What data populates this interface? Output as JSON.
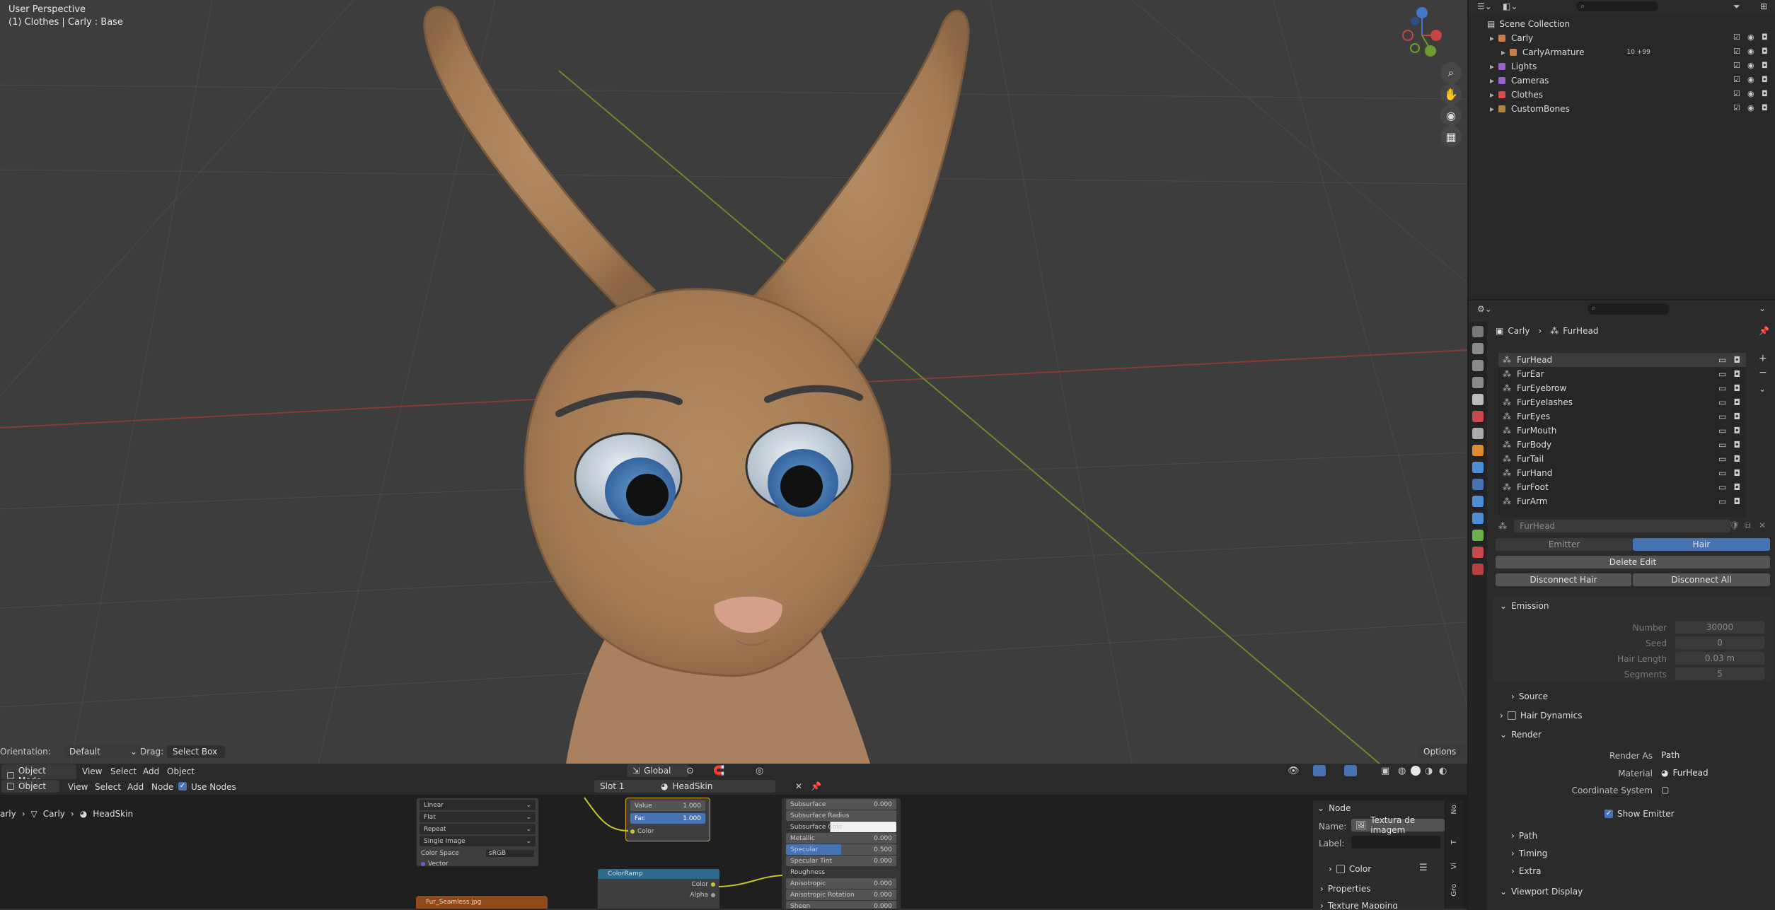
{
  "viewport": {
    "perspective": "User Perspective",
    "context": "(1) Clothes | Carly : Base",
    "orientation_label": "Orientation:",
    "orientation_value": "Default",
    "drag_label": "Drag:",
    "drag_value": "Select Box",
    "options_label": "Options"
  },
  "viewport_header": {
    "mode": "Object Mode",
    "menus": [
      "View",
      "Select",
      "Add",
      "Object"
    ],
    "transform_orientation": "Global"
  },
  "node_header": {
    "editor": "Object",
    "menus": [
      "View",
      "Select",
      "Add",
      "Node"
    ],
    "use_nodes_label": "Use Nodes",
    "slot": "Slot 1",
    "material": "HeadSkin"
  },
  "node_breadcrumb": {
    "items": [
      "arly",
      "Carly",
      "HeadSkin"
    ]
  },
  "node_sidebar": {
    "section": "Node",
    "name_label": "Name:",
    "name_value": "Textura de imagem",
    "label_label": "Label:",
    "color_label": "Color",
    "properties_label": "Properties",
    "texture_mapping_label": "Texture Mapping",
    "tabs": [
      "No",
      "T",
      "Vi",
      "Gro"
    ]
  },
  "nodes": {
    "image_texture": {
      "rows": [
        "Linear",
        "Flat",
        "Repeat",
        "Single Image"
      ],
      "color_space_label": "Color Space",
      "color_space_value": "sRGB",
      "vector_label": "Vector"
    },
    "fur_seamless": "Fur_Seamless.jpg",
    "mix": {
      "value_label": "Value",
      "value": "1.000",
      "fac_label": "Fac",
      "fac": "1.000",
      "color_label": "Color"
    },
    "colorramp": {
      "title": "ColorRamp",
      "color_label": "Color",
      "alpha_label": "Alpha"
    },
    "bsdf_rows": [
      {
        "label": "Subsurface",
        "value": "0.000"
      },
      {
        "label": "Subsurface Radius",
        "value": ""
      },
      {
        "label": "Subsurface Colo",
        "value": ""
      },
      {
        "label": "Metallic",
        "value": "0.000"
      },
      {
        "label": "Specular",
        "value": "0.500"
      },
      {
        "label": "Specular Tint",
        "value": "0.000"
      },
      {
        "label": "Roughness",
        "value": ""
      },
      {
        "label": "Anisotropic",
        "value": "0.000"
      },
      {
        "label": "Anisotropic Rotation",
        "value": "0.000"
      },
      {
        "label": "Sheen",
        "value": "0.000"
      }
    ]
  },
  "outliner": {
    "root": "Scene Collection",
    "items": [
      {
        "name": "Carly",
        "indent": 1,
        "color": "#c97f4a"
      },
      {
        "name": "CarlyArmature",
        "indent": 2,
        "color": "#c97f4a",
        "extra": "10 +99"
      },
      {
        "name": "Lights",
        "indent": 1,
        "color": "#9b62c9"
      },
      {
        "name": "Cameras",
        "indent": 1,
        "color": "#9b62c9"
      },
      {
        "name": "Clothes",
        "indent": 1,
        "color": "#d94c4c"
      },
      {
        "name": "CustomBones",
        "indent": 1,
        "color": "#b2843e"
      }
    ]
  },
  "properties": {
    "breadcrumb_object": "Carly",
    "breadcrumb_system": "FurHead",
    "particle_systems": [
      "FurHead",
      "FurEar",
      "FurEyebrow",
      "FurEyelashes",
      "FurEyes",
      "FurMouth",
      "FurBody",
      "FurTail",
      "FurHand",
      "FurFoot",
      "FurArm"
    ],
    "settings_name": "FurHead",
    "type_tabs": [
      "Emitter",
      "Hair"
    ],
    "delete_edit": "Delete Edit",
    "disconnect_hair": "Disconnect Hair",
    "disconnect_all": "Disconnect All",
    "emission": {
      "title": "Emission",
      "number_label": "Number",
      "number": "30000",
      "seed_label": "Seed",
      "seed": "0",
      "hair_length_label": "Hair Length",
      "hair_length": "0.03 m",
      "segments_label": "Segments",
      "segments": "5"
    },
    "source": "Source",
    "hair_dynamics": "Hair Dynamics",
    "render": {
      "title": "Render",
      "render_as_label": "Render As",
      "render_as": "Path",
      "material_label": "Material",
      "material": "FurHead",
      "coordinate_system_label": "Coordinate System",
      "show_emitter": "Show Emitter"
    },
    "path": "Path",
    "timing": "Timing",
    "extra": "Extra",
    "viewport_display": "Viewport Display"
  },
  "colors": {
    "accent_blue": "#4772b3",
    "fur": "#a9805a",
    "eye_iris": "#4f7fb8"
  }
}
